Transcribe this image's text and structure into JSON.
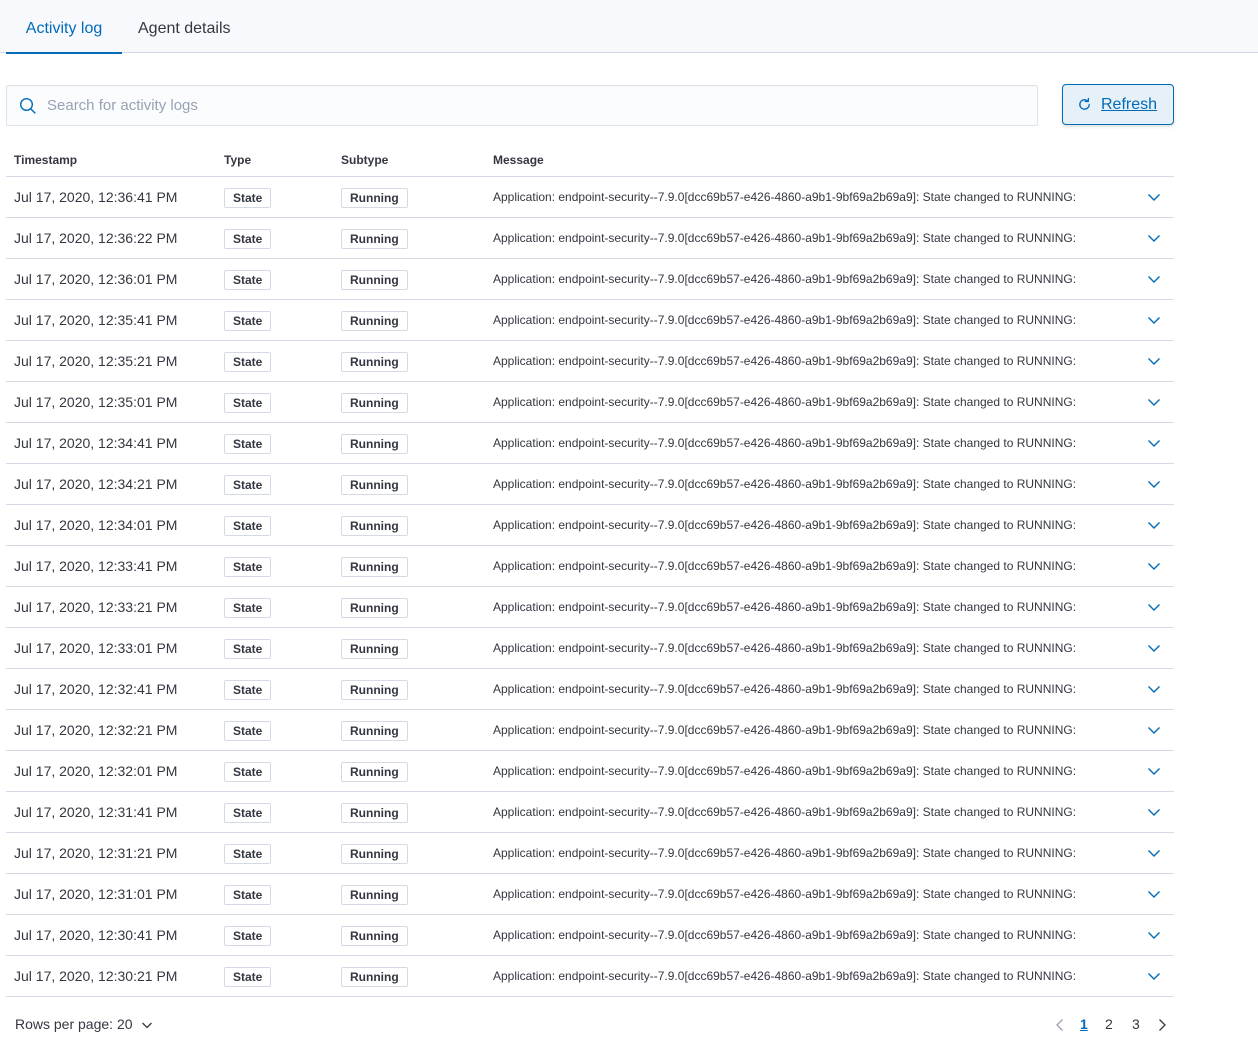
{
  "tabs": [
    {
      "label": "Activity log"
    },
    {
      "label": "Agent details"
    }
  ],
  "search": {
    "placeholder": "Search for activity logs"
  },
  "refresh": {
    "label": "Refresh"
  },
  "table": {
    "headers": {
      "timestamp": "Timestamp",
      "type": "Type",
      "subtype": "Subtype",
      "message": "Message"
    },
    "rows": [
      {
        "timestamp": "Jul 17, 2020, 12:36:41 PM",
        "type": "State",
        "subtype": "Running",
        "message": "Application: endpoint-security--7.9.0[dcc69b57-e426-4860-a9b1-9bf69a2b69a9]: State changed to RUNNING:"
      },
      {
        "timestamp": "Jul 17, 2020, 12:36:22 PM",
        "type": "State",
        "subtype": "Running",
        "message": "Application: endpoint-security--7.9.0[dcc69b57-e426-4860-a9b1-9bf69a2b69a9]: State changed to RUNNING:"
      },
      {
        "timestamp": "Jul 17, 2020, 12:36:01 PM",
        "type": "State",
        "subtype": "Running",
        "message": "Application: endpoint-security--7.9.0[dcc69b57-e426-4860-a9b1-9bf69a2b69a9]: State changed to RUNNING:"
      },
      {
        "timestamp": "Jul 17, 2020, 12:35:41 PM",
        "type": "State",
        "subtype": "Running",
        "message": "Application: endpoint-security--7.9.0[dcc69b57-e426-4860-a9b1-9bf69a2b69a9]: State changed to RUNNING:"
      },
      {
        "timestamp": "Jul 17, 2020, 12:35:21 PM",
        "type": "State",
        "subtype": "Running",
        "message": "Application: endpoint-security--7.9.0[dcc69b57-e426-4860-a9b1-9bf69a2b69a9]: State changed to RUNNING:"
      },
      {
        "timestamp": "Jul 17, 2020, 12:35:01 PM",
        "type": "State",
        "subtype": "Running",
        "message": "Application: endpoint-security--7.9.0[dcc69b57-e426-4860-a9b1-9bf69a2b69a9]: State changed to RUNNING:"
      },
      {
        "timestamp": "Jul 17, 2020, 12:34:41 PM",
        "type": "State",
        "subtype": "Running",
        "message": "Application: endpoint-security--7.9.0[dcc69b57-e426-4860-a9b1-9bf69a2b69a9]: State changed to RUNNING:"
      },
      {
        "timestamp": "Jul 17, 2020, 12:34:21 PM",
        "type": "State",
        "subtype": "Running",
        "message": "Application: endpoint-security--7.9.0[dcc69b57-e426-4860-a9b1-9bf69a2b69a9]: State changed to RUNNING:"
      },
      {
        "timestamp": "Jul 17, 2020, 12:34:01 PM",
        "type": "State",
        "subtype": "Running",
        "message": "Application: endpoint-security--7.9.0[dcc69b57-e426-4860-a9b1-9bf69a2b69a9]: State changed to RUNNING:"
      },
      {
        "timestamp": "Jul 17, 2020, 12:33:41 PM",
        "type": "State",
        "subtype": "Running",
        "message": "Application: endpoint-security--7.9.0[dcc69b57-e426-4860-a9b1-9bf69a2b69a9]: State changed to RUNNING:"
      },
      {
        "timestamp": "Jul 17, 2020, 12:33:21 PM",
        "type": "State",
        "subtype": "Running",
        "message": "Application: endpoint-security--7.9.0[dcc69b57-e426-4860-a9b1-9bf69a2b69a9]: State changed to RUNNING:"
      },
      {
        "timestamp": "Jul 17, 2020, 12:33:01 PM",
        "type": "State",
        "subtype": "Running",
        "message": "Application: endpoint-security--7.9.0[dcc69b57-e426-4860-a9b1-9bf69a2b69a9]: State changed to RUNNING:"
      },
      {
        "timestamp": "Jul 17, 2020, 12:32:41 PM",
        "type": "State",
        "subtype": "Running",
        "message": "Application: endpoint-security--7.9.0[dcc69b57-e426-4860-a9b1-9bf69a2b69a9]: State changed to RUNNING:"
      },
      {
        "timestamp": "Jul 17, 2020, 12:32:21 PM",
        "type": "State",
        "subtype": "Running",
        "message": "Application: endpoint-security--7.9.0[dcc69b57-e426-4860-a9b1-9bf69a2b69a9]: State changed to RUNNING:"
      },
      {
        "timestamp": "Jul 17, 2020, 12:32:01 PM",
        "type": "State",
        "subtype": "Running",
        "message": "Application: endpoint-security--7.9.0[dcc69b57-e426-4860-a9b1-9bf69a2b69a9]: State changed to RUNNING:"
      },
      {
        "timestamp": "Jul 17, 2020, 12:31:41 PM",
        "type": "State",
        "subtype": "Running",
        "message": "Application: endpoint-security--7.9.0[dcc69b57-e426-4860-a9b1-9bf69a2b69a9]: State changed to RUNNING:"
      },
      {
        "timestamp": "Jul 17, 2020, 12:31:21 PM",
        "type": "State",
        "subtype": "Running",
        "message": "Application: endpoint-security--7.9.0[dcc69b57-e426-4860-a9b1-9bf69a2b69a9]: State changed to RUNNING:"
      },
      {
        "timestamp": "Jul 17, 2020, 12:31:01 PM",
        "type": "State",
        "subtype": "Running",
        "message": "Application: endpoint-security--7.9.0[dcc69b57-e426-4860-a9b1-9bf69a2b69a9]: State changed to RUNNING:"
      },
      {
        "timestamp": "Jul 17, 2020, 12:30:41 PM",
        "type": "State",
        "subtype": "Running",
        "message": "Application: endpoint-security--7.9.0[dcc69b57-e426-4860-a9b1-9bf69a2b69a9]: State changed to RUNNING:"
      },
      {
        "timestamp": "Jul 17, 2020, 12:30:21 PM",
        "type": "State",
        "subtype": "Running",
        "message": "Application: endpoint-security--7.9.0[dcc69b57-e426-4860-a9b1-9bf69a2b69a9]: State changed to RUNNING:"
      }
    ]
  },
  "pagination": {
    "rows_per_page_label": "Rows per page: 20",
    "pages": [
      "1",
      "2",
      "3"
    ],
    "current_page": "1"
  },
  "icons": {
    "search": "search-icon",
    "refresh": "refresh-icon",
    "expand": "chevron-down-icon",
    "prev": "chevron-left-icon",
    "next": "chevron-right-icon"
  },
  "colors": {
    "accent": "#006bb8",
    "border": "#d3dae6",
    "text": "#343741",
    "placeholder": "#98a2b3"
  }
}
